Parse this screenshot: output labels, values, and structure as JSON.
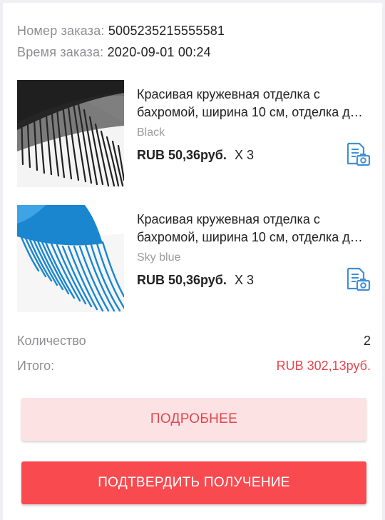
{
  "order": {
    "number_label": "Номер заказа:",
    "number_value": "5005235215555581",
    "time_label": "Время заказа:",
    "time_value": "2020-09-01 00:24"
  },
  "products": [
    {
      "title": "Красивая кружевная отделка с бахромой, ширина 10 см, отделка для платья",
      "variant": "Black",
      "price": "RUB 50,36руб.",
      "qty": "X 3",
      "image_color": "#1f1f1f",
      "image_icon": "fringe-black-image"
    },
    {
      "title": "Красивая кружевная отделка с бахромой, ширина 10 см, отделка для платья",
      "variant": "Sky blue",
      "price": "RUB 50,36руб.",
      "qty": "X 3",
      "image_color": "#1a86d0",
      "image_icon": "fringe-blue-image"
    }
  ],
  "summary": {
    "qty_label": "Количество",
    "qty_value": "2",
    "total_label": "Итого:",
    "total_value": "RUB 302,13руб."
  },
  "buttons": {
    "details_label": "ПОДРОБНЕЕ",
    "confirm_label": "ПОДТВЕРДИТЬ ПОЛУЧЕНИЕ"
  },
  "colors": {
    "accent": "#e5454d",
    "confirm_bg": "#f94a4f",
    "details_bg": "#fde2e3",
    "icon_blue": "#3f8fd6"
  }
}
